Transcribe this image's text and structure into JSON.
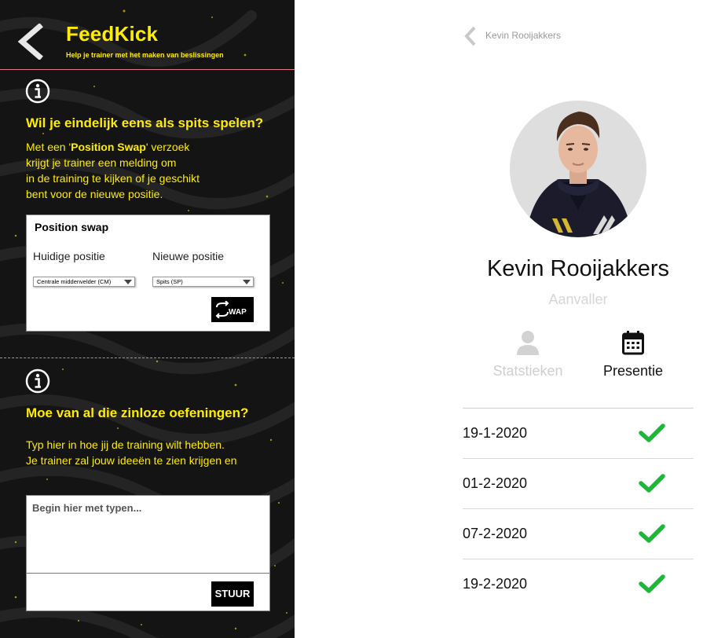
{
  "app": {
    "title": "FeedKick",
    "subtitle": "Help je trainer met het maken van beslissingen"
  },
  "position_swap": {
    "heading": "Wil je eindelijk eens als spits spelen?",
    "text_prefix": "Met een '",
    "text_bold": "Position Swap",
    "text_suffix_line1": "' verzoek",
    "text_lines": [
      "krijgt je trainer een melding om",
      "in de training te kijken of je geschikt",
      "bent voor de nieuwe positie."
    ],
    "card_title": "Position swap",
    "current_label": "Huidige positie",
    "new_label": "Nieuwe positie",
    "current_value": "Centrale middenvelder (CM)",
    "new_value": "Spits (SP)",
    "button_label": "WAP"
  },
  "feedback": {
    "heading": "Moe van al die zinloze oefeningen?",
    "text_lines": [
      "Typ hier in hoe jij de training wilt hebben.",
      "Je trainer zal jouw ideeën te zien krijgen en"
    ],
    "placeholder": "Begin hier met typen...",
    "button_label": "STUUR"
  },
  "profile": {
    "breadcrumb": "Kevin Rooijakkers",
    "name": "Kevin Rooijakkers",
    "role": "Aanvaller",
    "tabs": [
      {
        "label": "Statstieken",
        "icon": "person-icon",
        "active": false
      },
      {
        "label": "Presentie",
        "icon": "calendar-icon",
        "active": true
      }
    ],
    "attendance": [
      {
        "date": "19-1-2020",
        "present": true
      },
      {
        "date": "01-2-2020",
        "present": true
      },
      {
        "date": "07-2-2020",
        "present": true
      },
      {
        "date": "19-2-2020",
        "present": true
      }
    ]
  },
  "colors": {
    "accent_yellow": "#ffec00",
    "panel_dark": "#141414",
    "separator_pink": "#e07a8a",
    "check_green": "#1fb53a",
    "muted_gray": "#cfcfcf"
  }
}
